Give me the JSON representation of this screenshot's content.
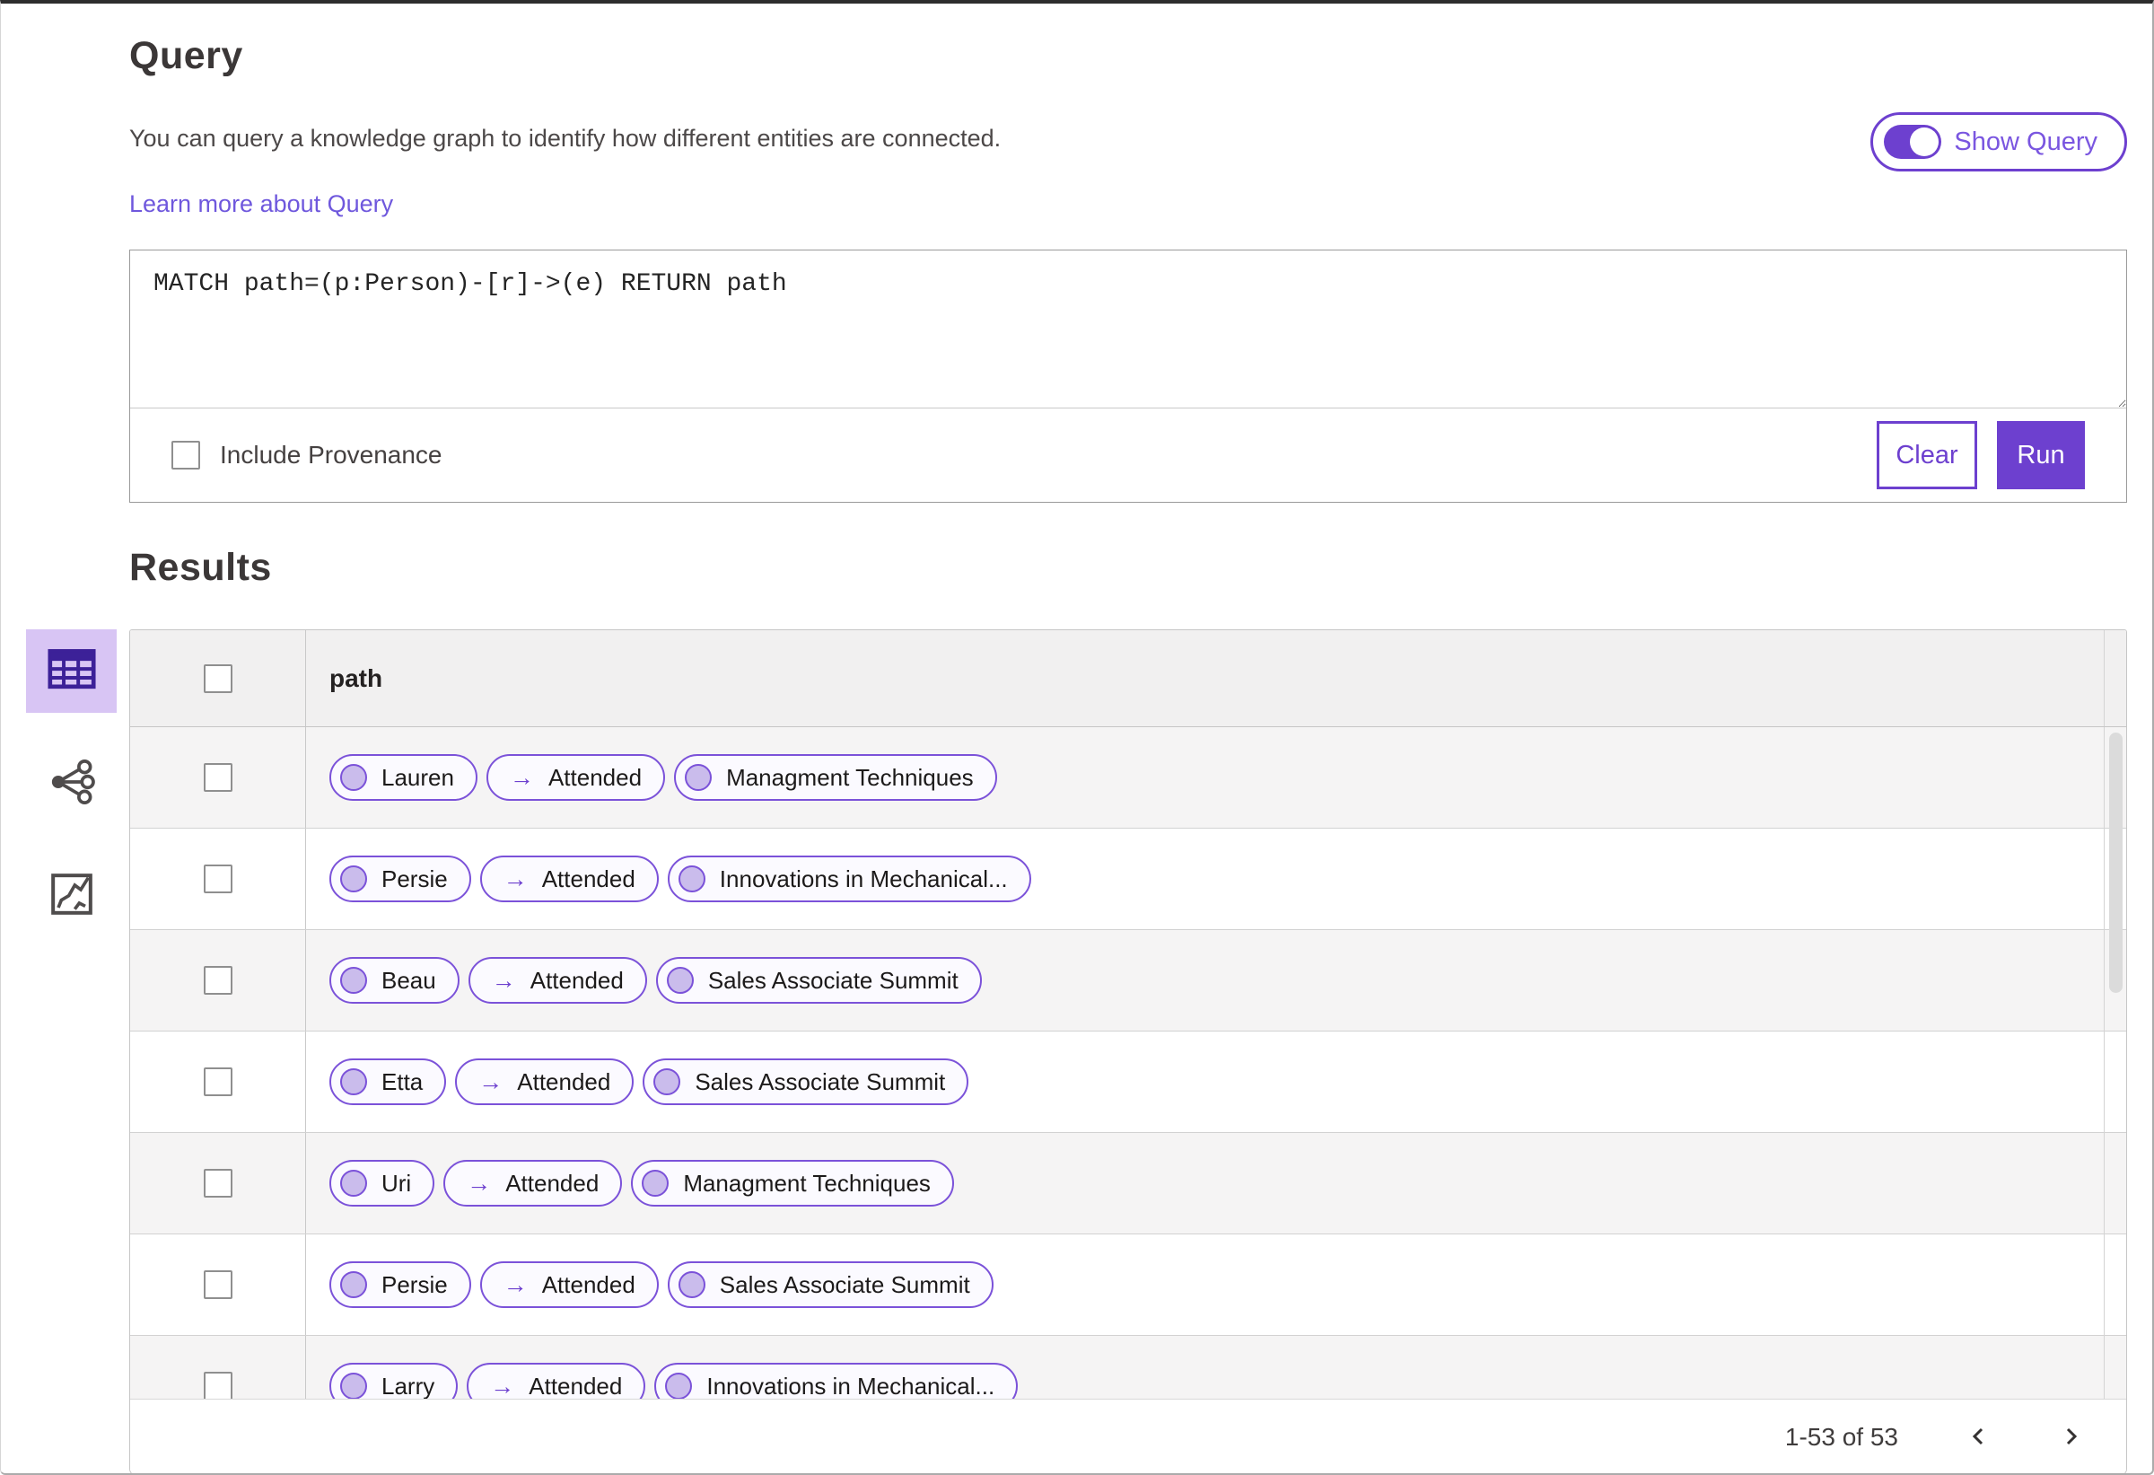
{
  "query": {
    "title": "Query",
    "description": "You can query a knowledge graph to identify how different entities are connected.",
    "learn_more_label": "Learn more about Query",
    "show_query_label": "Show Query",
    "show_query_on": true,
    "query_text": "MATCH path=(p:Person)-[r]->(e) RETURN path",
    "include_provenance_label": "Include Provenance",
    "include_provenance_checked": false,
    "clear_label": "Clear",
    "run_label": "Run"
  },
  "results": {
    "title": "Results",
    "views": [
      {
        "name": "table-view",
        "icon": "table-grid-icon",
        "selected": true
      },
      {
        "name": "graph-view",
        "icon": "network-nodes-icon",
        "selected": false
      },
      {
        "name": "chart-view",
        "icon": "line-chart-box-icon",
        "selected": false
      }
    ],
    "table": {
      "columns": [
        "path"
      ],
      "select_all_checked": false,
      "rows": [
        {
          "source": "Lauren",
          "edge": "Attended",
          "target": "Managment Techniques",
          "checked": false
        },
        {
          "source": "Persie",
          "edge": "Attended",
          "target": "Innovations in Mechanical...",
          "checked": false
        },
        {
          "source": "Beau",
          "edge": "Attended",
          "target": "Sales Associate Summit",
          "checked": false
        },
        {
          "source": "Etta",
          "edge": "Attended",
          "target": "Sales Associate Summit",
          "checked": false
        },
        {
          "source": "Uri",
          "edge": "Attended",
          "target": "Managment Techniques",
          "checked": false
        },
        {
          "source": "Persie",
          "edge": "Attended",
          "target": "Sales Associate Summit",
          "checked": false
        },
        {
          "source": "Larry",
          "edge": "Attended",
          "target": "Innovations in Mechanical...",
          "checked": false
        }
      ]
    },
    "pagination": {
      "range_label": "1-53 of 53"
    }
  },
  "icons": {
    "edge_arrow": "→",
    "prev": "chevron-left",
    "next": "chevron-right"
  },
  "colors": {
    "accent_purple": "#6d40cf",
    "chip_border": "#7b52d9",
    "chip_dot_fill": "#cabcec",
    "selected_tile_bg": "#d8c5f4",
    "table_header_bg": "#f1f0f0",
    "row_stripe_bg": "#f5f4f4",
    "link_purple": "#6f58dd"
  }
}
